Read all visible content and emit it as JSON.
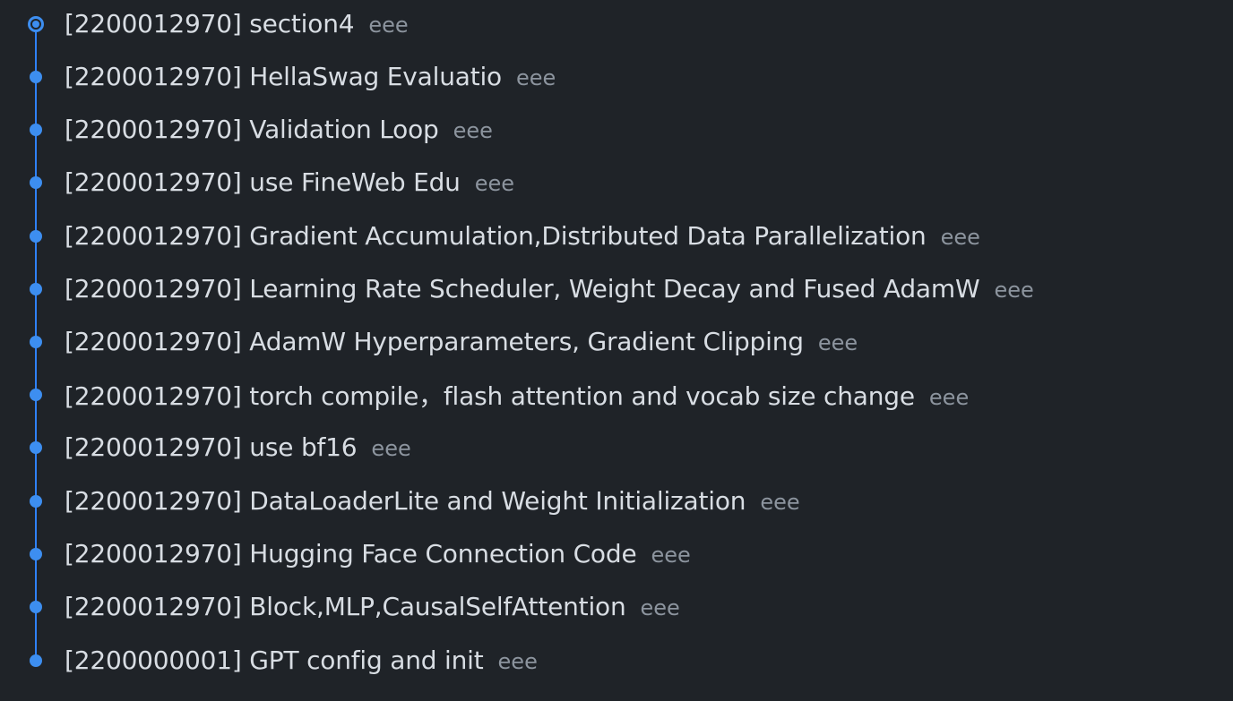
{
  "commits": [
    {
      "message": "[2200012970] section4",
      "author": "eee",
      "is_head": true
    },
    {
      "message": "[2200012970] HellaSwag Evaluatio",
      "author": "eee",
      "is_head": false
    },
    {
      "message": "[2200012970] Validation Loop",
      "author": "eee",
      "is_head": false
    },
    {
      "message": "[2200012970] use FineWeb Edu",
      "author": "eee",
      "is_head": false
    },
    {
      "message": "[2200012970] Gradient Accumulation,Distributed Data Parallelization",
      "author": "eee",
      "is_head": false
    },
    {
      "message": "[2200012970] Learning Rate Scheduler, Weight Decay and Fused AdamW",
      "author": "eee",
      "is_head": false
    },
    {
      "message": "[2200012970] AdamW Hyperparameters, Gradient Clipping",
      "author": "eee",
      "is_head": false
    },
    {
      "message": "[2200012970] torch compile，flash attention and vocab size change",
      "author": "eee",
      "is_head": false
    },
    {
      "message": "[2200012970] use bf16",
      "author": "eee",
      "is_head": false
    },
    {
      "message": "[2200012970] DataLoaderLite and Weight Initialization",
      "author": "eee",
      "is_head": false
    },
    {
      "message": "[2200012970] Hugging Face Connection Code",
      "author": "eee",
      "is_head": false
    },
    {
      "message": "[2200012970] Block,MLP,CausalSelfAttention",
      "author": "eee",
      "is_head": false
    },
    {
      "message": "[2200000001] GPT config and init",
      "author": "eee",
      "is_head": false
    }
  ],
  "colors": {
    "background": "#1f2328",
    "graph": "#3d8ef0",
    "message": "#d8dde3",
    "author": "#8c949e"
  }
}
